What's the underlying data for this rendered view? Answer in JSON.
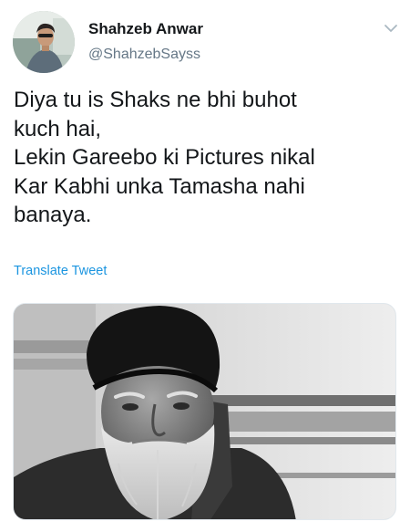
{
  "tweet": {
    "author_name": "Shahzeb Anwar",
    "author_handle": "@ShahzebSayss",
    "text": "Diya tu is Shaks ne bhi buhot\nkuch hai,\nLekin Gareebo ki Pictures nikal\nKar Kabhi unka Tamasha nahi\nbanaya.",
    "translate_label": "Translate Tweet"
  },
  "icons": {
    "menu": "chevron-down-icon"
  },
  "colors": {
    "link": "#1b95e0",
    "secondary_text": "#657786",
    "primary_text": "#14171a"
  }
}
